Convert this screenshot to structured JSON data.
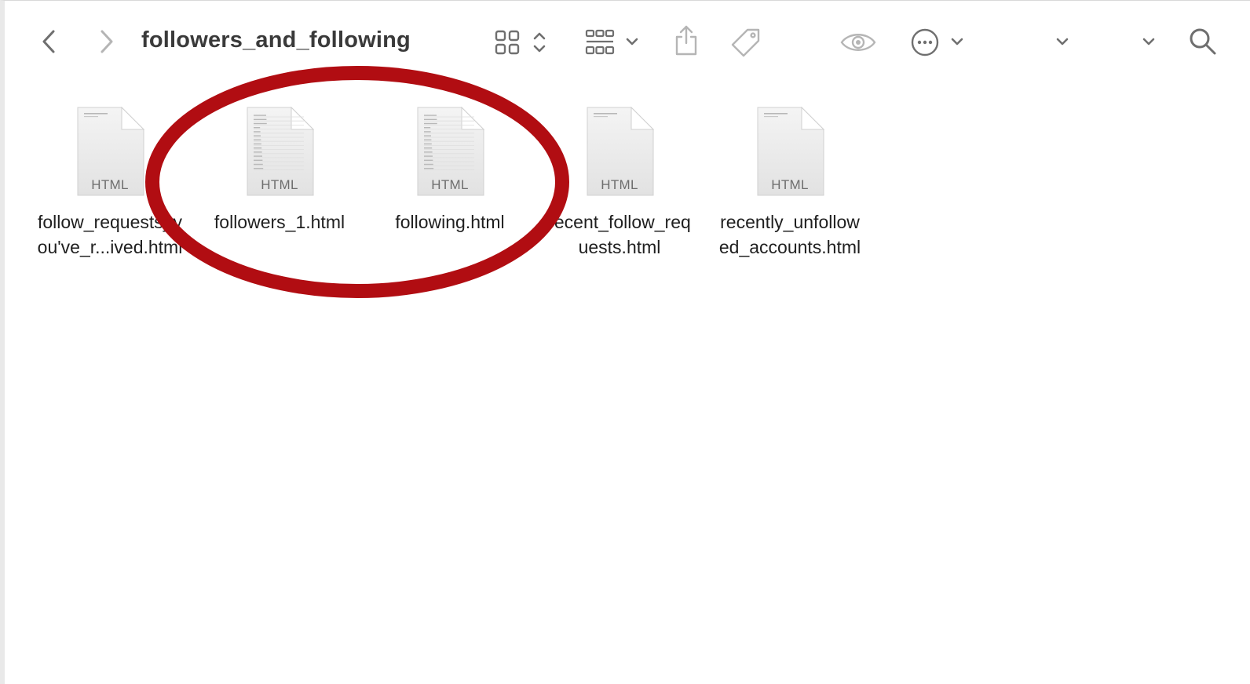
{
  "window": {
    "title": "followers_and_following"
  },
  "toolbar": {
    "icons": [
      "back-chevron-icon",
      "forward-chevron-icon",
      "icon-grid-view-icon",
      "sort-updown-icon",
      "group-by-icon",
      "chevron-down-icon",
      "share-icon",
      "tag-icon",
      "quick-look-eye-icon",
      "more-actions-icon",
      "chevron-down-icon",
      "chevron-down-icon",
      "chevron-down-icon",
      "search-icon"
    ]
  },
  "files": [
    {
      "name": "follow_requests_y\nou've_r...ived.html",
      "type": "HTML",
      "lined": false
    },
    {
      "name": "followers_1.html",
      "type": "HTML",
      "lined": true
    },
    {
      "name": "following.html",
      "type": "HTML",
      "lined": true
    },
    {
      "name": "recent_follow_req\nuests.html",
      "type": "HTML",
      "lined": false
    },
    {
      "name": "recently_unfollow\ned_accounts.html",
      "type": "HTML",
      "lined": false
    }
  ],
  "annotation": {
    "shape": "ellipse",
    "color": "#b10d12",
    "encloses": [
      "followers_1.html",
      "following.html"
    ]
  },
  "colors": {
    "icon_gray": "#6f6f6f",
    "disabled_gray": "#b5b5b5",
    "title_text": "#3a3a3a"
  }
}
